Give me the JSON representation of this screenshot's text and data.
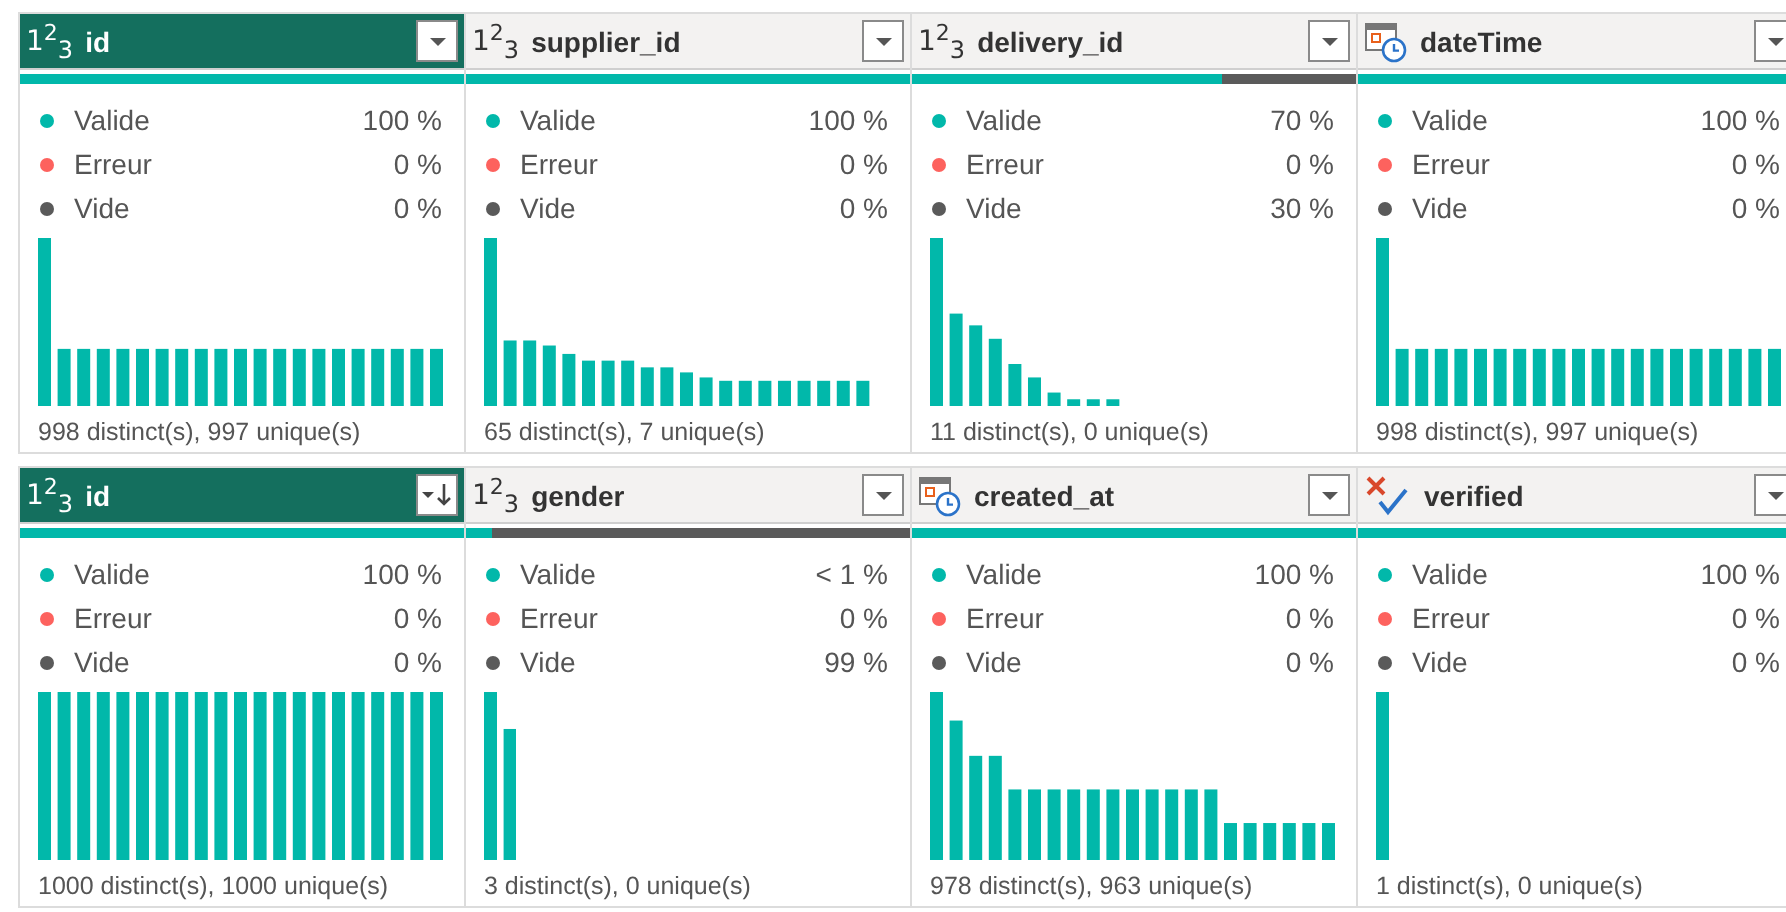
{
  "rows": [
    {
      "columns": [
        {
          "name": "id",
          "kind": "number",
          "type_glyph": "1$^{2}$$_{3}$",
          "selected": true,
          "sorted": false,
          "quality_bar": {
            "level": 1
          },
          "stats": [
            {
              "label": "Valide",
              "value": "100 %",
              "color": "#01b8aa"
            },
            {
              "label": "Erreur",
              "value": "0 %",
              "color": "#fd625e"
            },
            {
              "label": "Vide",
              "value": "0 %",
              "color": "#5a5a5a"
            }
          ],
          "summary": "998 distinct(s), 997 unique(s)"
        },
        {
          "name": "supplier_id",
          "kind": "number",
          "type_glyph": "1$^{2}$$_{3}$",
          "selected": false,
          "sorted": false,
          "quality_bar": {
            "level": 1
          },
          "stats": [
            {
              "label": "Valide",
              "value": "100 %",
              "color": "#01b8aa"
            },
            {
              "label": "Erreur",
              "value": "0 %",
              "color": "#fd625e"
            },
            {
              "label": "Vide",
              "value": "0 %",
              "color": "#5a5a5a"
            }
          ],
          "summary": "65 distinct(s), 7 unique(s)"
        },
        {
          "name": "delivery_id",
          "kind": "number",
          "type_glyph": "1$^{2}$$_{3}$",
          "selected": false,
          "sorted": false,
          "quality_bar": {
            "level": 0.7
          },
          "stats": [
            {
              "label": "Valide",
              "value": "70 %",
              "color": "#01b8aa"
            },
            {
              "label": "Erreur",
              "value": "0 %",
              "color": "#fd625e"
            },
            {
              "label": "Vide",
              "value": "30 %",
              "color": "#5a5a5a"
            }
          ],
          "summary": "11 distinct(s), 0 unique(s)"
        },
        {
          "name": "dateTime",
          "kind": "datetime",
          "selected": false,
          "sorted": false,
          "quality_bar": {
            "level": 1
          },
          "stats": [
            {
              "label": "Valide",
              "value": "100 %",
              "color": "#01b8aa"
            },
            {
              "label": "Erreur",
              "value": "0 %",
              "color": "#fd625e"
            },
            {
              "label": "Vide",
              "value": "0 %",
              "color": "#5a5a5a"
            }
          ],
          "summary": "998 distinct(s), 997 unique(s)"
        }
      ]
    },
    {
      "columns": [
        {
          "name": "id",
          "kind": "number",
          "type_glyph": "1$^{2}$$_{3}$",
          "selected": true,
          "sorted": true,
          "quality_bar": {
            "level": 1
          },
          "stats": [
            {
              "label": "Valide",
              "value": "100 %",
              "color": "#01b8aa"
            },
            {
              "label": "Erreur",
              "value": "0 %",
              "color": "#fd625e"
            },
            {
              "label": "Vide",
              "value": "0 %",
              "color": "#5a5a5a"
            }
          ],
          "summary": "1000 distinct(s), 1000 unique(s)"
        },
        {
          "name": "gender",
          "kind": "number",
          "type_glyph": "1$^{2}$$_{3}$",
          "selected": false,
          "sorted": false,
          "quality_bar": {
            "level": 0.06
          },
          "stats": [
            {
              "label": "Valide",
              "value": "< 1 %",
              "color": "#01b8aa"
            },
            {
              "label": "Erreur",
              "value": "0 %",
              "color": "#fd625e"
            },
            {
              "label": "Vide",
              "value": "99 %",
              "color": "#5a5a5a"
            }
          ],
          "summary": "3 distinct(s), 0 unique(s)"
        },
        {
          "name": "created_at",
          "kind": "datetime",
          "selected": false,
          "sorted": false,
          "quality_bar": {
            "level": 1
          },
          "stats": [
            {
              "label": "Valide",
              "value": "100 %",
              "color": "#01b8aa"
            },
            {
              "label": "Erreur",
              "value": "0 %",
              "color": "#fd625e"
            },
            {
              "label": "Vide",
              "value": "0 %",
              "color": "#5a5a5a"
            }
          ],
          "summary": "978 distinct(s), 963 unique(s)"
        },
        {
          "name": "verified",
          "kind": "boolean",
          "selected": false,
          "sorted": false,
          "quality_bar": {
            "level": 1
          },
          "stats": [
            {
              "label": "Valide",
              "value": "100 %",
              "color": "#01b8aa"
            },
            {
              "label": "Erreur",
              "value": "0 %",
              "color": "#fd625e"
            },
            {
              "label": "Vide",
              "value": "0 %",
              "color": "#5a5a5a"
            }
          ],
          "summary": "1 distinct(s), 0 unique(s)"
        }
      ]
    }
  ]
}
